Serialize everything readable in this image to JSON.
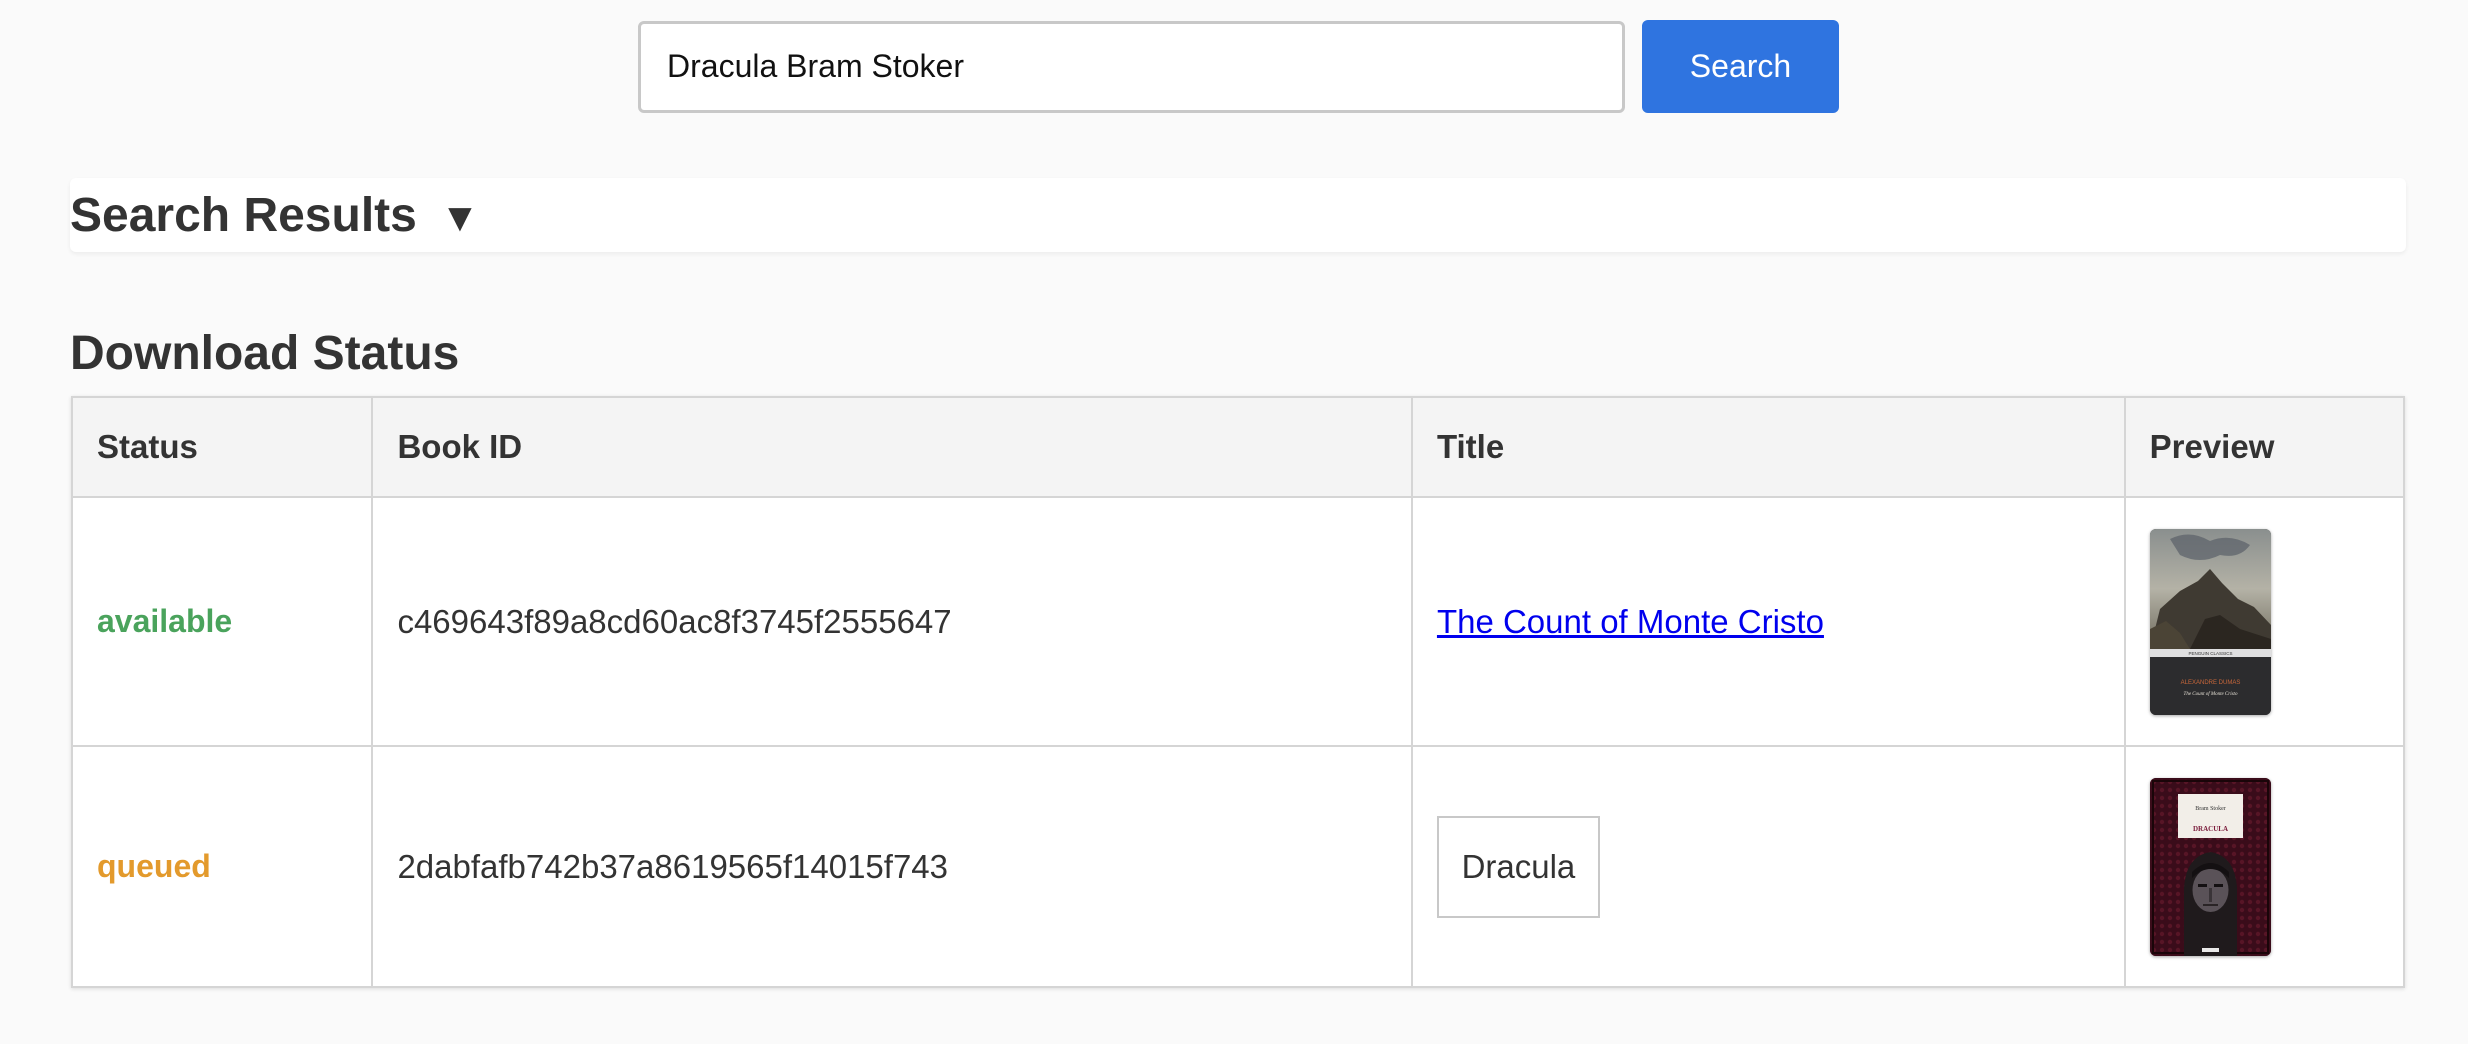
{
  "search": {
    "query": "Dracula Bram Stoker",
    "button_label": "Search"
  },
  "results": {
    "title": "Search Results",
    "toggle_icon": "▼"
  },
  "downloads": {
    "title": "Download Status",
    "columns": [
      "Status",
      "Book ID",
      "Title",
      "Preview"
    ],
    "rows": [
      {
        "status": "available",
        "book_id": "c469643f89a8cd60ac8f3745f2555647",
        "title": "The Count of Monte Cristo",
        "cover_author": "ALEXANDRE DUMAS",
        "cover_title": "The Count of Monte Cristo",
        "cover_series": "PENGUIN CLASSICS"
      },
      {
        "status": "queued",
        "book_id": "2dabfafb742b37a8619565f14015f743",
        "title": "Dracula",
        "cover_author": "Bram Stoker",
        "cover_title": "DRACULA"
      }
    ]
  },
  "colors": {
    "accent": "#2f74e0",
    "available": "#4aa35c",
    "queued": "#e39a2c",
    "link": "#0000ee"
  }
}
